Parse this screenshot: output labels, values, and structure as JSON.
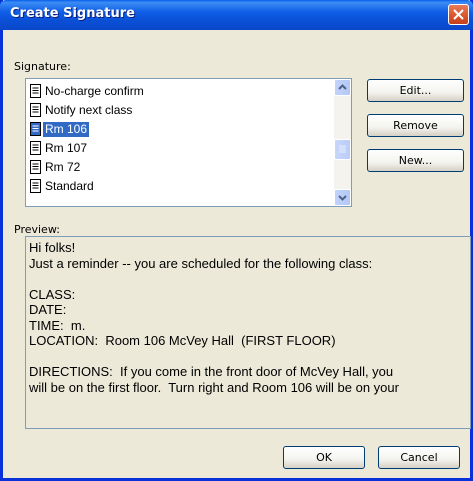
{
  "window": {
    "title": "Create Signature"
  },
  "signature": {
    "label": "Signature:",
    "items": [
      {
        "label": "No-charge confirm",
        "selected": false
      },
      {
        "label": "Notify next class",
        "selected": false
      },
      {
        "label": "Rm 106",
        "selected": true
      },
      {
        "label": "Rm 107",
        "selected": false
      },
      {
        "label": "Rm 72",
        "selected": false
      },
      {
        "label": "Standard",
        "selected": false
      }
    ]
  },
  "buttons": {
    "edit": "Edit...",
    "remove": "Remove",
    "new": "New...",
    "ok": "OK",
    "cancel": "Cancel"
  },
  "preview": {
    "label": "Preview:",
    "lines": [
      "Hi folks!",
      "Just a reminder -- you are scheduled for the following class:",
      "",
      "CLASS:",
      "DATE:",
      "TIME:  m.",
      "LOCATION:  Room 106 McVey Hall  (FIRST FLOOR)",
      "",
      "DIRECTIONS:  If you come in the front door of McVey Hall, you",
      "will be on the first floor.  Turn right and Room 106 will be on your"
    ]
  },
  "colors": {
    "title_bar": "#0A4FD6",
    "selection": "#316AC5",
    "dialog_bg": "#ECE9D8",
    "close_button": "#D9532B"
  },
  "icons": {
    "close": "close-icon",
    "signature_item": "document-icon",
    "scroll_up": "arrow-up-icon",
    "scroll_down": "arrow-down-icon"
  }
}
